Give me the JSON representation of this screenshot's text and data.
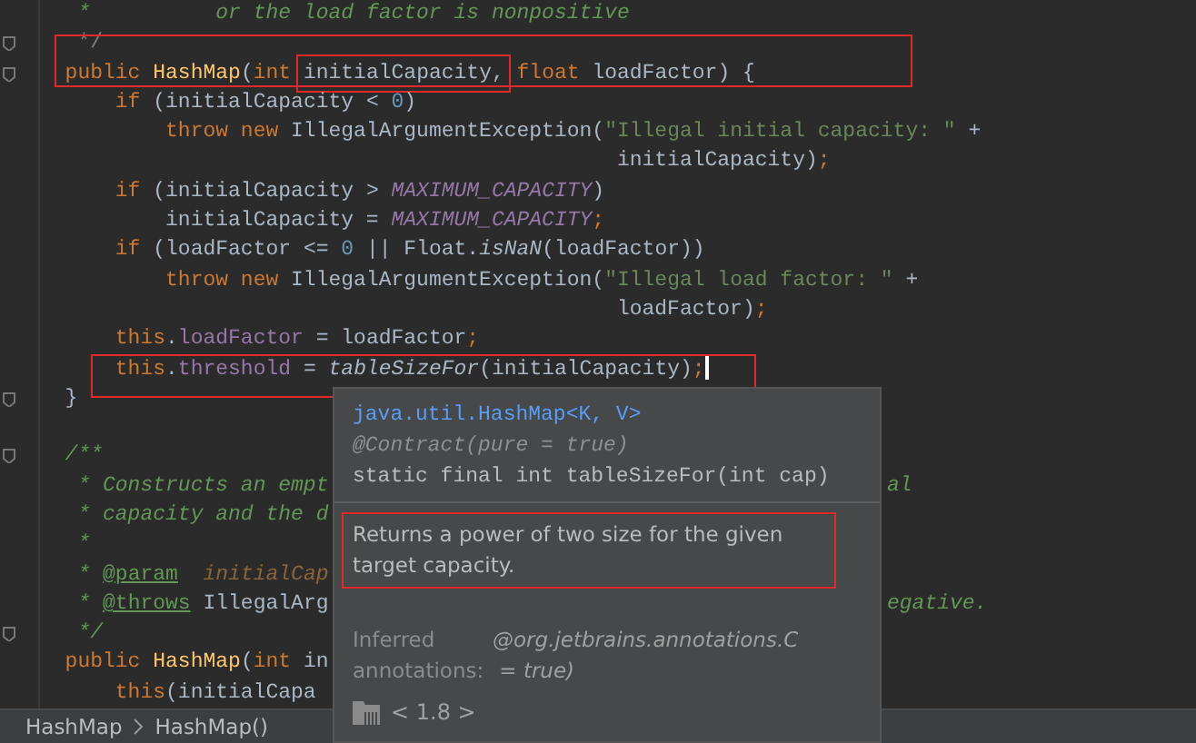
{
  "editor": {
    "lines": [
      {
        "tokens": [
          {
            "text": "   *          or the load factor is nonpositive",
            "kind": "doc"
          }
        ]
      },
      {
        "fold": true,
        "tokens": [
          {
            "text": "   */",
            "kind": "comment"
          }
        ]
      },
      {
        "fold": true,
        "tokens": [
          {
            "text": "  public ",
            "kind": "kw"
          },
          {
            "text": "HashMap",
            "kind": "decl"
          },
          {
            "text": "(",
            "kind": "plain"
          },
          {
            "text": "int ",
            "kind": "kw"
          },
          {
            "text": "initialCapacity,",
            "kind": "plain",
            "boxed": true
          },
          {
            "text": " float ",
            "kind": "kw"
          },
          {
            "text": "loadFactor) {",
            "kind": "plain"
          }
        ]
      },
      {
        "tokens": [
          {
            "text": "      if ",
            "kind": "kw"
          },
          {
            "text": "(initialCapacity < ",
            "kind": "plain"
          },
          {
            "text": "0",
            "kind": "num"
          },
          {
            "text": ")",
            "kind": "plain"
          }
        ]
      },
      {
        "tokens": [
          {
            "text": "          throw new ",
            "kind": "kw"
          },
          {
            "text": "IllegalArgumentException(",
            "kind": "plain"
          },
          {
            "text": "\"Illegal initial capacity: \"",
            "kind": "str"
          },
          {
            "text": " +",
            "kind": "plain"
          }
        ]
      },
      {
        "tokens": [
          {
            "text": "                                              initialCapacity)",
            "kind": "plain"
          },
          {
            "text": ";",
            "kind": "kw"
          }
        ]
      },
      {
        "tokens": [
          {
            "text": "      if ",
            "kind": "kw"
          },
          {
            "text": "(initialCapacity > ",
            "kind": "plain"
          },
          {
            "text": "MAXIMUM_CAPACITY",
            "kind": "const"
          },
          {
            "text": ")",
            "kind": "plain"
          }
        ]
      },
      {
        "tokens": [
          {
            "text": "          initialCapacity = ",
            "kind": "plain"
          },
          {
            "text": "MAXIMUM_CAPACITY",
            "kind": "const"
          },
          {
            "text": ";",
            "kind": "kw"
          }
        ]
      },
      {
        "tokens": [
          {
            "text": "      if ",
            "kind": "kw"
          },
          {
            "text": "(loadFactor <= ",
            "kind": "plain"
          },
          {
            "text": "0",
            "kind": "num"
          },
          {
            "text": " || Float.",
            "kind": "plain"
          },
          {
            "text": "isNaN",
            "kind": "call"
          },
          {
            "text": "(loadFactor))",
            "kind": "plain"
          }
        ]
      },
      {
        "tokens": [
          {
            "text": "          throw new ",
            "kind": "kw"
          },
          {
            "text": "IllegalArgumentException(",
            "kind": "plain"
          },
          {
            "text": "\"Illegal load factor: \"",
            "kind": "str"
          },
          {
            "text": " +",
            "kind": "plain"
          }
        ]
      },
      {
        "tokens": [
          {
            "text": "                                              loadFactor)",
            "kind": "plain"
          },
          {
            "text": ";",
            "kind": "kw"
          }
        ]
      },
      {
        "tokens": [
          {
            "text": "      this",
            "kind": "kw"
          },
          {
            "text": ".",
            "kind": "plain"
          },
          {
            "text": "loadFactor",
            "kind": "field"
          },
          {
            "text": " = loadFactor",
            "kind": "plain"
          },
          {
            "text": ";",
            "kind": "kw"
          }
        ]
      },
      {
        "caret": true,
        "tokens": [
          {
            "text": "      this",
            "kind": "kw"
          },
          {
            "text": ".",
            "kind": "plain"
          },
          {
            "text": "threshold",
            "kind": "field"
          },
          {
            "text": " = ",
            "kind": "plain"
          },
          {
            "text": "tableSizeFor",
            "kind": "call"
          },
          {
            "text": "(initialCapacity)",
            "kind": "plain"
          },
          {
            "text": ";",
            "kind": "kw"
          }
        ]
      },
      {
        "fold": true,
        "tokens": [
          {
            "text": "  }",
            "kind": "plain"
          }
        ]
      },
      {
        "kind": "blank"
      },
      {
        "fold": true,
        "tokens": [
          {
            "text": "  /**",
            "kind": "doc"
          }
        ]
      },
      {
        "tokens": [
          {
            "text": "   * Constructs an empt",
            "kind": "doc"
          }
        ],
        "tail": "al"
      },
      {
        "tokens": [
          {
            "text": "   * capacity and the d",
            "kind": "doc"
          }
        ]
      },
      {
        "tokens": [
          {
            "text": "   *",
            "kind": "doc"
          }
        ]
      },
      {
        "tokens": [
          {
            "text": "   * ",
            "kind": "doc"
          },
          {
            "text": "@param",
            "kind": "doctag"
          },
          {
            "text": "  initialCap",
            "kind": "docparam"
          }
        ]
      },
      {
        "tokens": [
          {
            "text": "   * ",
            "kind": "doc"
          },
          {
            "text": "@throws",
            "kind": "doctag"
          },
          {
            "text": " IllegalArg",
            "kind": "plain"
          }
        ],
        "tail": "egative."
      },
      {
        "fold": true,
        "tokens": [
          {
            "text": "   */",
            "kind": "doc"
          }
        ]
      },
      {
        "tokens": [
          {
            "text": "  public ",
            "kind": "kw"
          },
          {
            "text": "HashMap",
            "kind": "decl"
          },
          {
            "text": "(",
            "kind": "plain"
          },
          {
            "text": "int ",
            "kind": "kw"
          },
          {
            "text": "in",
            "kind": "plain"
          }
        ]
      },
      {
        "tokens": [
          {
            "text": "      this",
            "kind": "kw"
          },
          {
            "text": "(initialCapa",
            "kind": "plain"
          }
        ]
      }
    ]
  },
  "popup": {
    "signature": [
      {
        "text": "java.util.HashMap<K, V>",
        "kind": "link"
      },
      {
        "text": "@Contract(pure = true)",
        "kind": "annotation"
      },
      {
        "text": "static final int tableSizeFor(int cap)",
        "kind": "plain"
      }
    ],
    "description": "Returns a power of two size for the given target capacity.",
    "inferred": {
      "label": "Inferred annotations:",
      "value": "@org.jetbrains.annotations.C\n = true)"
    },
    "version": "< 1.8 >"
  },
  "breadcrumbs": [
    "HashMap",
    "HashMap()"
  ]
}
